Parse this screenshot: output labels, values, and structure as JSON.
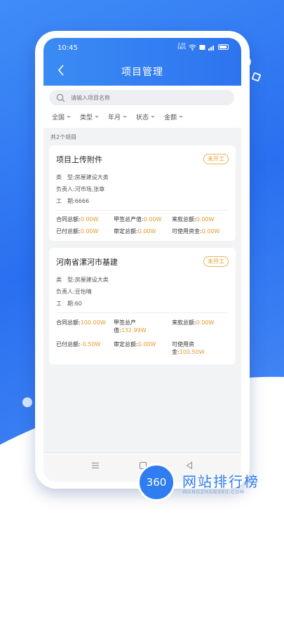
{
  "status_bar": {
    "time": "10:45",
    "speed": "2.00\nKB/S"
  },
  "nav": {
    "title": "项目管理"
  },
  "search": {
    "placeholder": "请输入项目名称"
  },
  "filters": [
    "全国",
    "类型",
    "年月",
    "状态",
    "金额"
  ],
  "list": {
    "count_text": "共2个项目",
    "projects": [
      {
        "title": "项目上传附件",
        "status": "未开工",
        "type": "类　型:房屋建设大类",
        "owner": "负责人:河市场,张章",
        "period": "工　期:6666",
        "stats": [
          {
            "label": "合同总额:",
            "value": "0.00W"
          },
          {
            "label": "甲签总产值:",
            "value": "0.00W"
          },
          {
            "label": "来款总额:",
            "value": "0.00W"
          },
          {
            "label": "已付总额:",
            "value": "0.00W"
          },
          {
            "label": "审定总额:",
            "value": "0.00W"
          },
          {
            "label": "可使用资金:",
            "value": "0.00W"
          }
        ]
      },
      {
        "title": "河南省漯河市基建",
        "status": "未开工",
        "type": "类　型:房屋建设大类",
        "owner": "负责人:豆怡晴",
        "period": "工　期:60",
        "stats": [
          {
            "label": "合同总额:",
            "value": "100.00W"
          },
          {
            "label": "甲签总产值:",
            "value": "132.99W"
          },
          {
            "label": "来款总额:",
            "value": "0.00W"
          },
          {
            "label": "已付总额:",
            "value": "-0.50W"
          },
          {
            "label": "审定总额:",
            "value": "0.00W"
          },
          {
            "label": "可使用资金:",
            "value": "100.50W"
          }
        ]
      }
    ]
  },
  "watermark": {
    "badge": "360",
    "name": "网站排行榜",
    "domain": "WANGZHAN360.COM"
  },
  "colors": {
    "primary": "#2d74ef",
    "accent": "#e49a2c",
    "background": "#f2f3f5"
  }
}
